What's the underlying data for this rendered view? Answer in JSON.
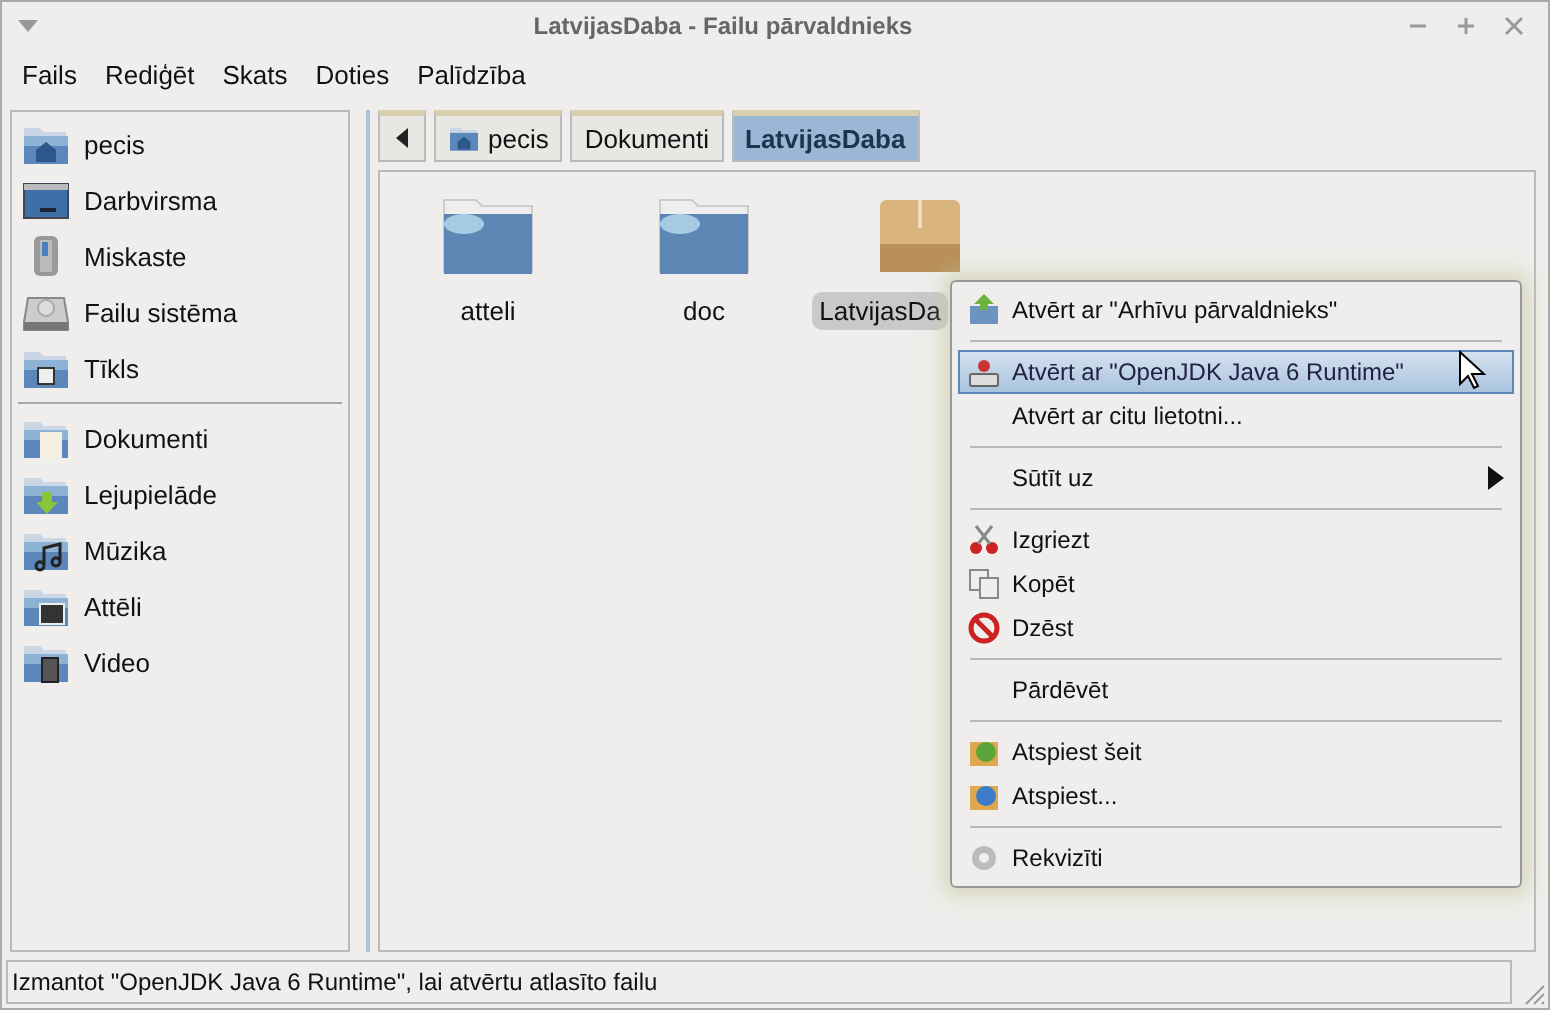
{
  "window": {
    "title": "LatvijasDaba - Failu pārvaldnieks"
  },
  "menubar": [
    "Fails",
    "Rediģēt",
    "Skats",
    "Doties",
    "Palīdzība"
  ],
  "sidebar": {
    "groups": [
      [
        {
          "label": "pecis",
          "selected": false
        },
        {
          "label": "Darbvirsma",
          "selected": false
        },
        {
          "label": "Miskaste",
          "selected": false
        },
        {
          "label": "Failu sistēma",
          "selected": false
        },
        {
          "label": "Tīkls",
          "selected": false
        }
      ],
      [
        {
          "label": "Dokumenti",
          "selected": false
        },
        {
          "label": "Lejupielāde",
          "selected": false
        },
        {
          "label": "Mūzika",
          "selected": false
        },
        {
          "label": "Attēli",
          "selected": false
        },
        {
          "label": "Video",
          "selected": false
        }
      ]
    ]
  },
  "path_bar": [
    {
      "label": "pecis",
      "selected": false
    },
    {
      "label": "Dokumenti",
      "selected": false
    },
    {
      "label": "LatvijasDaba",
      "selected": true
    }
  ],
  "files": [
    {
      "name": "atteli",
      "kind": "folder",
      "selected": false
    },
    {
      "name": "doc",
      "kind": "folder",
      "selected": false
    },
    {
      "name": "LatvijasDa",
      "kind": "archive",
      "selected": true
    }
  ],
  "context_menu": [
    [
      {
        "label": "Atvērt ar \"Arhīvu pārvaldnieks\"",
        "selected": false,
        "submenu": false
      }
    ],
    [
      {
        "label": "Atvērt ar \"OpenJDK Java 6 Runtime\"",
        "selected": true,
        "submenu": false
      },
      {
        "label": "Atvērt ar citu lietotni...",
        "selected": false,
        "submenu": false
      }
    ],
    [
      {
        "label": "Sūtīt uz",
        "selected": false,
        "submenu": true
      }
    ],
    [
      {
        "label": "Izgriezt",
        "selected": false,
        "submenu": false
      },
      {
        "label": "Kopēt",
        "selected": false,
        "submenu": false
      },
      {
        "label": "Dzēst",
        "selected": false,
        "submenu": false
      }
    ],
    [
      {
        "label": "Pārdēvēt",
        "selected": false,
        "submenu": false
      }
    ],
    [
      {
        "label": "Atspiest šeit",
        "selected": false,
        "submenu": false
      },
      {
        "label": "Atspiest...",
        "selected": false,
        "submenu": false
      }
    ],
    [
      {
        "label": "Rekvizīti",
        "selected": false,
        "submenu": false
      }
    ]
  ],
  "status_bar": "Izmantot \"OpenJDK Java 6 Runtime\", lai atvērtu atlasīto failu"
}
